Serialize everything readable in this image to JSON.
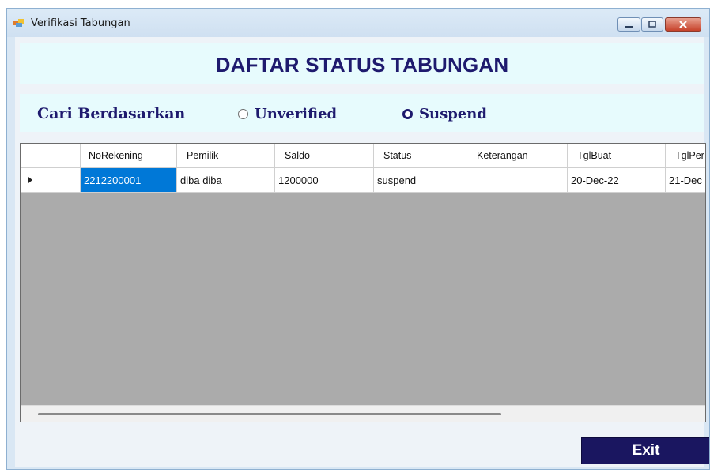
{
  "window": {
    "title": "Verifikasi Tabungan",
    "controls": {
      "minimize": "minimize-icon",
      "maximize": "maximize-icon",
      "close": "close-icon"
    }
  },
  "header": {
    "title": "DAFTAR STATUS TABUNGAN"
  },
  "search": {
    "label": "Cari Berdasarkan",
    "options": [
      {
        "label": "Unverified",
        "checked": false
      },
      {
        "label": "Suspend",
        "checked": true
      }
    ]
  },
  "table": {
    "columns": [
      "NoRekening",
      "Pemilik",
      "Saldo",
      "Status",
      "Keterangan",
      "TglBuat",
      "TglPer"
    ],
    "rows": [
      [
        "2212200001",
        "diba diba",
        "1200000",
        "suspend",
        "",
        "20-Dec-22",
        "21-Dec"
      ]
    ]
  },
  "footer": {
    "exit_label": "Exit"
  },
  "colors": {
    "accent": "#1e1a6e",
    "button": "#1a1660",
    "selected": "#0078d7",
    "panel": "#e7fbfd"
  }
}
